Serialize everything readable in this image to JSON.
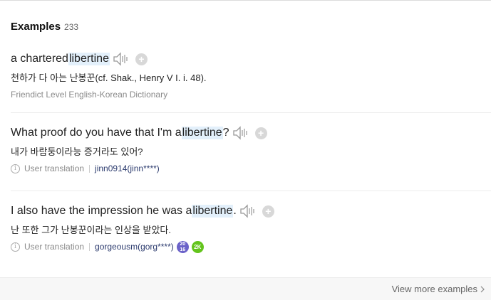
{
  "section": {
    "title": "Examples",
    "count": "233"
  },
  "examples": [
    {
      "before": "a chartered ",
      "highlight": "libertine",
      "after": "",
      "translation": "천하가 다 아는 난봉꾼(cf. Shak., Henry V I. i. 48).",
      "source": "Friendict Level English-Korean Dictionary"
    },
    {
      "before": "What proof do you have that I'm a ",
      "highlight": "libertine",
      "after": "?",
      "translation": "내가 바람둥이라능 증거라도 있어?",
      "source": "User translation",
      "user": "jinn0914(jinn****)"
    },
    {
      "before": "I also have the impression he was a ",
      "highlight": "libertine",
      "after": ".",
      "translation": "난 또한 그가 난봉꾼이라는 인상을 받았다.",
      "source": "User translation",
      "user": "gorgeousm(gorg****)",
      "badges": [
        "20",
        "16",
        "2K"
      ]
    }
  ],
  "icons": {
    "speaker": "speaker-icon",
    "add": "plus-icon",
    "info": "info-icon",
    "chevron": "chevron-right-icon"
  },
  "add_symbol": "+",
  "info_symbol": "i",
  "footer": {
    "view_more": "View more examples"
  },
  "colors": {
    "highlight": "#e3f0fb",
    "badge_year": "#6b62c9",
    "badge_2k": "#63c41c"
  }
}
